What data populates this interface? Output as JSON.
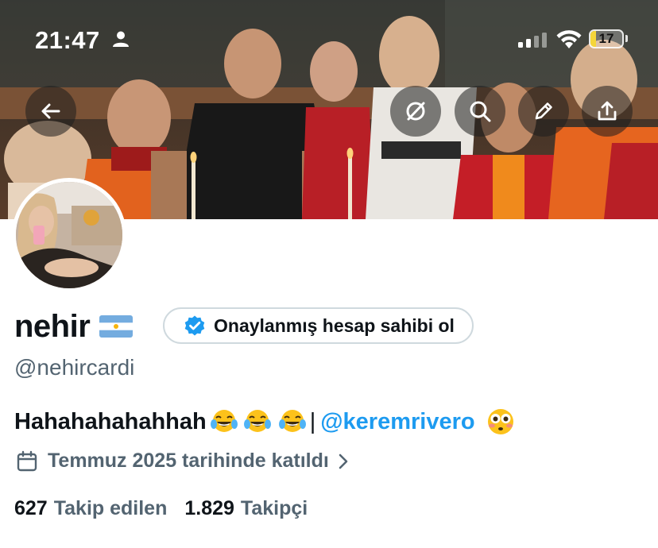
{
  "status_bar": {
    "time": "21:47",
    "battery_level": "17",
    "battery_fraction": 0.17
  },
  "banner_buttons": {
    "back_icon": "arrow-left-icon",
    "grok_icon": "grok-icon",
    "search_icon": "search-icon",
    "edit_icon": "pencil-icon",
    "share_icon": "share-icon"
  },
  "profile": {
    "display_name": "nehir",
    "flag": "argentina-flag",
    "verify_cta": "Onaylanmış hesap sahibi ol",
    "handle": "@nehircardi",
    "bio_text": "Hahahahahahhah",
    "bio_separator": "|",
    "bio_mention": "@keremrivero",
    "bio_emojis": [
      "face-with-tears-of-joy",
      "face-with-tears-of-joy",
      "face-with-tears-of-joy",
      "flushed-face"
    ],
    "joined": "Temmuz 2025 tarihinde katıldı",
    "following_count": "627",
    "following_label": "Takip edilen",
    "followers_count": "1.829",
    "followers_label": "Takipçi"
  },
  "colors": {
    "accent": "#1d9bf0",
    "text_primary": "#0f1419",
    "text_secondary": "#536471",
    "border": "#cfd9de",
    "battery": "#f5d63a"
  }
}
